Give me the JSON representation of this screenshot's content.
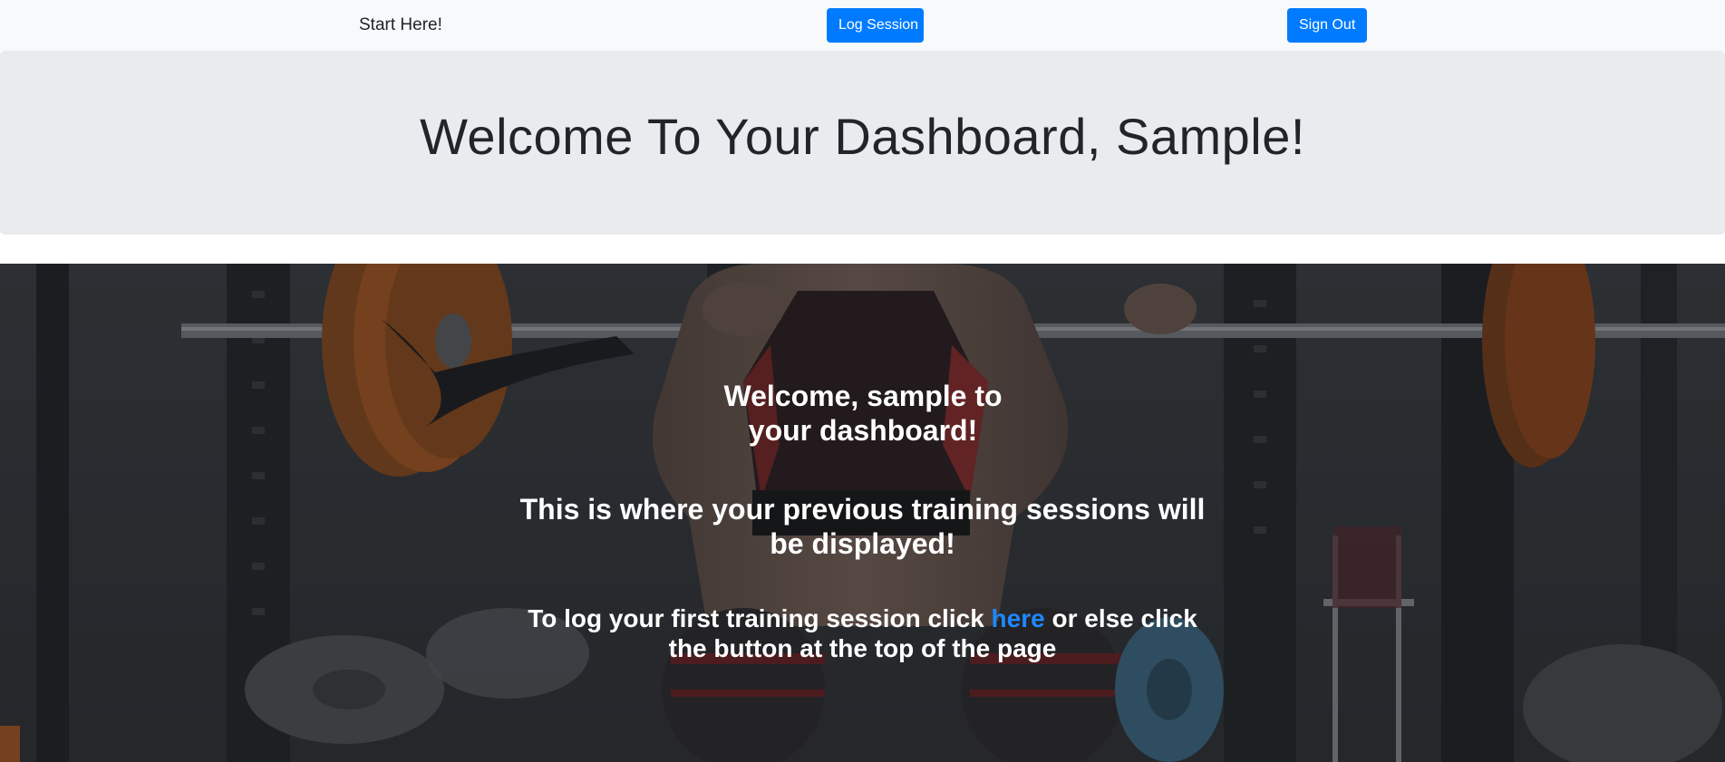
{
  "navbar": {
    "brand": "Start Here!",
    "log_session_label": "Log Session",
    "sign_out_label": "Sign Out"
  },
  "jumbotron": {
    "title": "Welcome To Your Dashboard, Sample!"
  },
  "hero": {
    "welcome": "Welcome, sample to your dashboard!",
    "info": "This is where your previous training sessions will be displayed!",
    "log_prefix": "To log your first training session click ",
    "log_link": "here",
    "log_suffix": " or else click the button at the top of the page"
  },
  "colors": {
    "navbar_bg": "#f8f9fa",
    "primary": "#007bff",
    "jumbotron_bg": "#e9ecef",
    "link": "#1e88ff"
  }
}
